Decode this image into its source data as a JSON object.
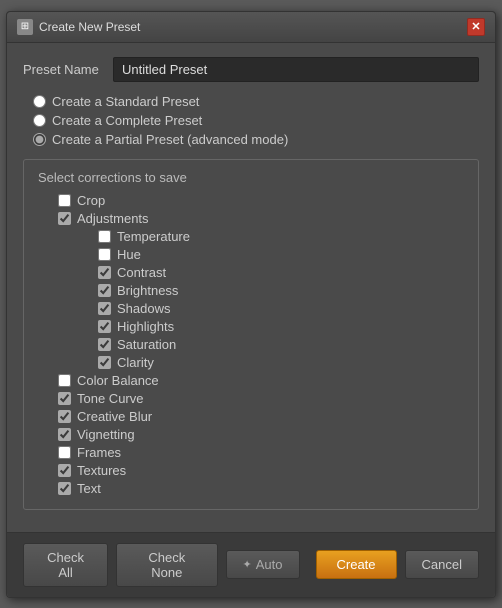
{
  "titleBar": {
    "title": "Create New Preset",
    "closeLabel": "✕"
  },
  "presetName": {
    "label": "Preset Name",
    "value": "Untitled Preset"
  },
  "radioOptions": [
    {
      "id": "standard",
      "label": "Create a Standard Preset",
      "checked": false
    },
    {
      "id": "complete",
      "label": "Create a Complete Preset",
      "checked": false
    },
    {
      "id": "partial",
      "label": "Create a Partial Preset (advanced mode)",
      "checked": true
    }
  ],
  "correctionsTitle": "Select corrections to save",
  "checkboxes": {
    "crop": {
      "label": "Crop",
      "checked": false,
      "indent": "indent1"
    },
    "adjustments": {
      "label": "Adjustments",
      "checked": true,
      "indent": "indent1"
    },
    "temperature": {
      "label": "Temperature",
      "checked": false,
      "indent": "indent3"
    },
    "hue": {
      "label": "Hue",
      "checked": false,
      "indent": "indent3"
    },
    "contrast": {
      "label": "Contrast",
      "checked": true,
      "indent": "indent3"
    },
    "brightness": {
      "label": "Brightness",
      "checked": true,
      "indent": "indent3"
    },
    "shadows": {
      "label": "Shadows",
      "checked": true,
      "indent": "indent3"
    },
    "highlights": {
      "label": "Highlights",
      "checked": true,
      "indent": "indent3"
    },
    "saturation": {
      "label": "Saturation",
      "checked": true,
      "indent": "indent3"
    },
    "clarity": {
      "label": "Clarity",
      "checked": true,
      "indent": "indent3"
    },
    "colorBalance": {
      "label": "Color Balance",
      "checked": false,
      "indent": "indent1"
    },
    "toneCurve": {
      "label": "Tone Curve",
      "checked": true,
      "indent": "indent1"
    },
    "creativeBlur": {
      "label": "Creative Blur",
      "checked": true,
      "indent": "indent1"
    },
    "vignetting": {
      "label": "Vignetting",
      "checked": true,
      "indent": "indent1"
    },
    "frames": {
      "label": "Frames",
      "checked": false,
      "indent": "indent1"
    },
    "textures": {
      "label": "Textures",
      "checked": true,
      "indent": "indent1"
    },
    "text": {
      "label": "Text",
      "checked": true,
      "indent": "indent1"
    }
  },
  "buttons": {
    "checkAll": "Check All",
    "checkNone": "Check None",
    "auto": "Auto",
    "create": "Create",
    "cancel": "Cancel"
  }
}
